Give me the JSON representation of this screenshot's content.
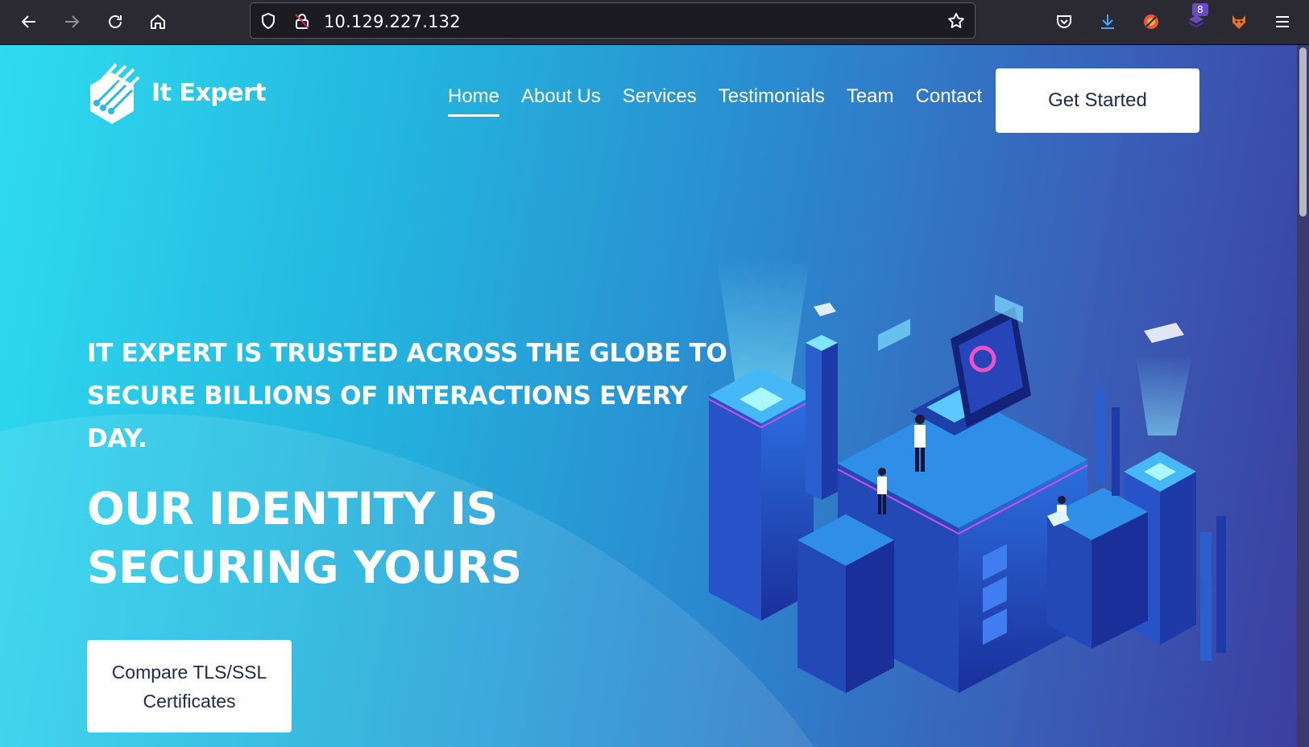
{
  "browser": {
    "url": "10.129.227.132",
    "extension_badge_count": "8"
  },
  "site": {
    "logo_text": "It Expert",
    "nav": [
      "Home",
      "About Us",
      "Services",
      "Testimonials",
      "Team",
      "Contact"
    ],
    "cta_label": "Get Started"
  },
  "hero": {
    "tagline": "IT EXPERT IS TRUSTED ACROSS THE GLOBE TO SECURE BILLIONS OF INTERACTIONS EVERY DAY.",
    "headline": "OUR IDENTITY IS SECURING YOURS",
    "button_label": "Compare TLS/SSL Certificates"
  },
  "colors": {
    "gradient_start": "#2fdbf0",
    "gradient_end": "#3b3fa0",
    "button_bg": "#ffffff"
  }
}
